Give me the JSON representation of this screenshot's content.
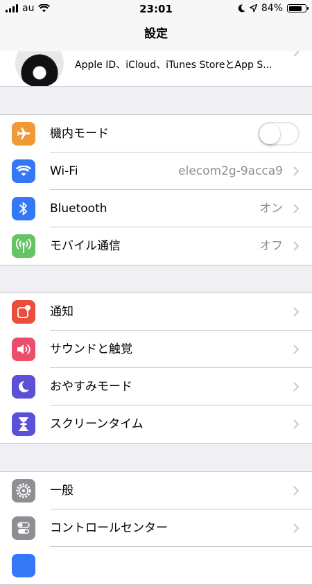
{
  "status_bar": {
    "carrier": "au",
    "time": "23:01",
    "battery": "84%",
    "battery_level": 0.84,
    "icons": [
      "signal-icon",
      "wifi-icon",
      "moon-icon",
      "location-arrow-icon",
      "battery-icon"
    ]
  },
  "nav": {
    "title": "設定"
  },
  "profile": {
    "subtitle": "Apple ID、iCloud、iTunes StoreとApp S..."
  },
  "groups": [
    {
      "items": [
        {
          "label": "機内モード",
          "icon": "airplane-icon",
          "color": "#f09a37",
          "control": "toggle",
          "toggle_on": false
        },
        {
          "label": "Wi-Fi",
          "value": "elecom2g-9acca9",
          "icon": "wifi-icon",
          "color": "#3478f6"
        },
        {
          "label": "Bluetooth",
          "value": "オン",
          "icon": "bluetooth-icon",
          "color": "#3478f6"
        },
        {
          "label": "モバイル通信",
          "value": "オフ",
          "icon": "antenna-icon",
          "color": "#65c466"
        }
      ]
    },
    {
      "items": [
        {
          "label": "通知",
          "icon": "notifications-icon",
          "color": "#eb4d3d"
        },
        {
          "label": "サウンドと触覚",
          "icon": "speaker-icon",
          "color": "#eb4e6a"
        },
        {
          "label": "おやすみモード",
          "icon": "moon-icon",
          "color": "#5b51d8"
        },
        {
          "label": "スクリーンタイム",
          "icon": "hourglass-icon",
          "color": "#5b51d8"
        }
      ]
    },
    {
      "items": [
        {
          "label": "一般",
          "icon": "gear-icon",
          "color": "#8e8e93"
        },
        {
          "label": "コントロールセンター",
          "icon": "control-center-icon",
          "color": "#8e8e93"
        }
      ]
    }
  ]
}
